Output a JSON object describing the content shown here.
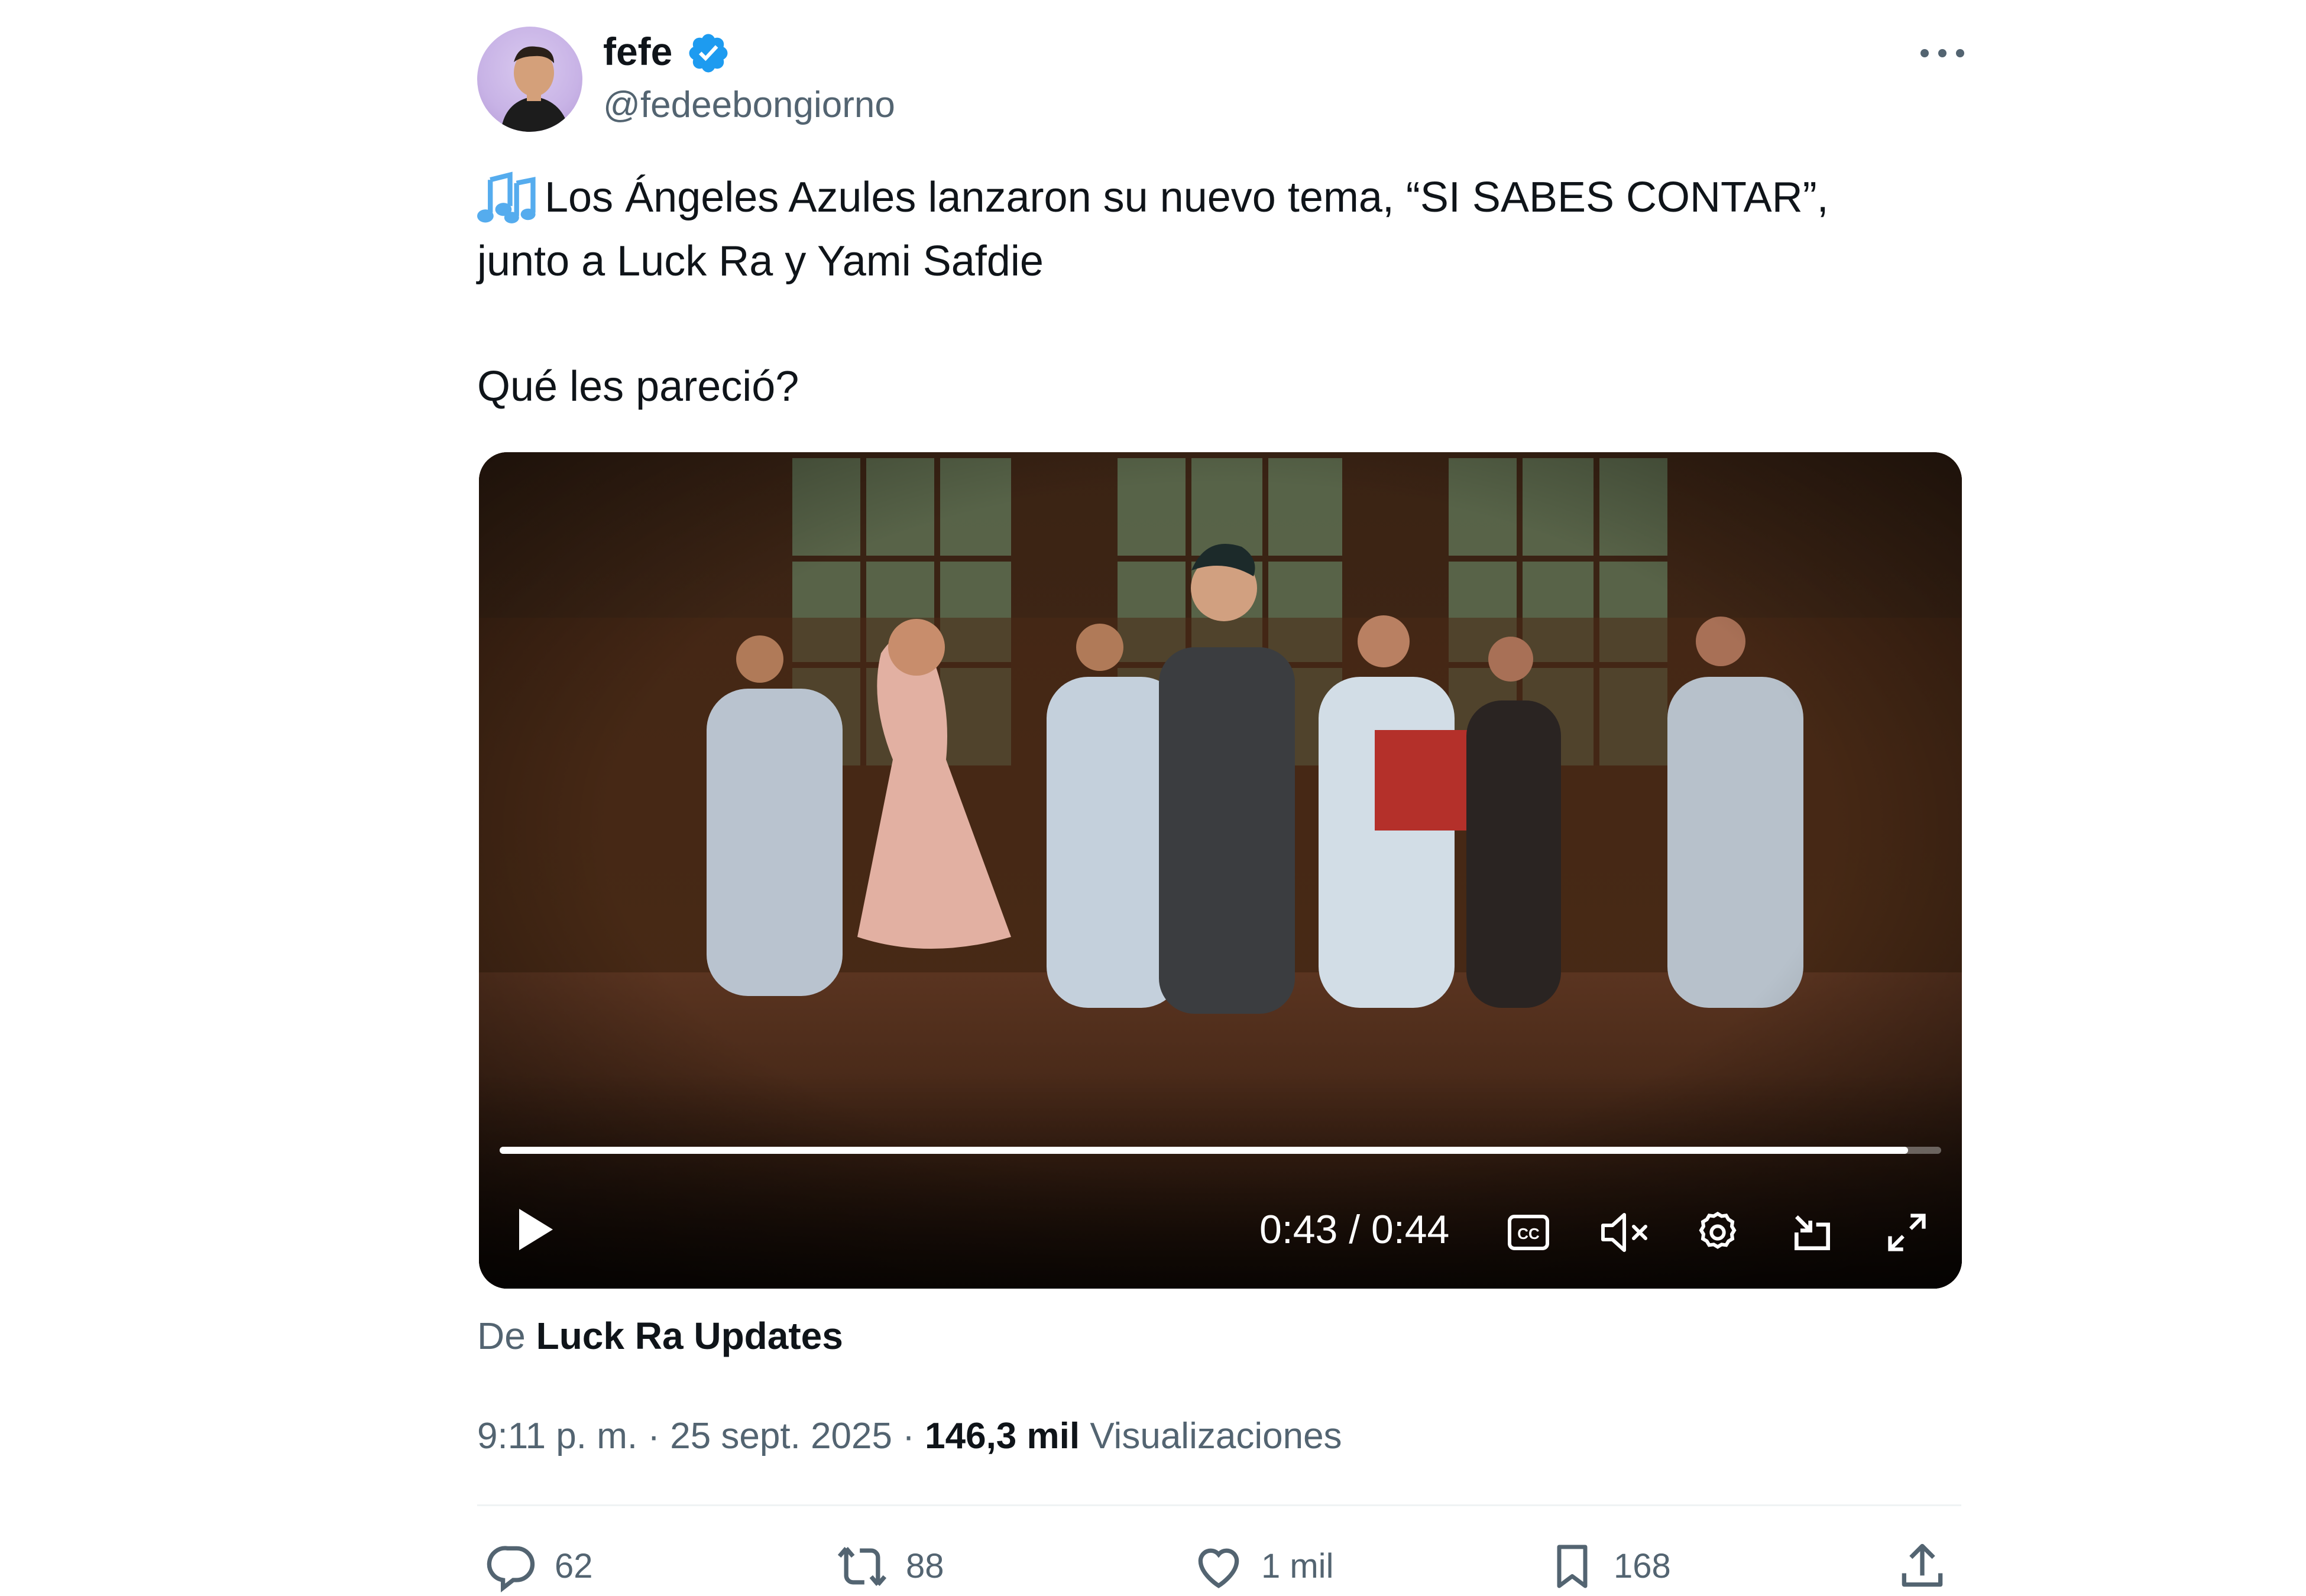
{
  "author": {
    "display_name": "fefe",
    "handle": "@fedeebongiorno",
    "verified": true
  },
  "tweet": {
    "line1": "Los Ángeles Azules lanzaron su nuevo tema, “SI SABES CONTAR”,",
    "line2": "junto a Luck Ra y Yami Safdie",
    "line3": "Qué les pareció?",
    "emoji": "music-notes-emoji"
  },
  "video": {
    "time_display": "0:43 / 0:44",
    "progress": 0.977,
    "muted": true,
    "controls": [
      "play-icon",
      "closed-captions-icon",
      "mute-icon",
      "settings-icon",
      "picture-in-picture-icon",
      "fullscreen-icon"
    ]
  },
  "source": {
    "prefix": "De",
    "name": "Luck Ra Updates"
  },
  "meta": {
    "time": "9:11 p. m.",
    "separator": "·",
    "date": "25 sept. 2025",
    "views_count": "146,3 mil",
    "views_label": "Visualizaciones"
  },
  "actions": {
    "replies": "62",
    "reposts": "88",
    "likes": "1 mil",
    "bookmarks": "168"
  },
  "colors": {
    "text": "#0f1419",
    "secondary": "#536471",
    "verified": "#1d9bf0",
    "divider": "#eff3f4"
  }
}
